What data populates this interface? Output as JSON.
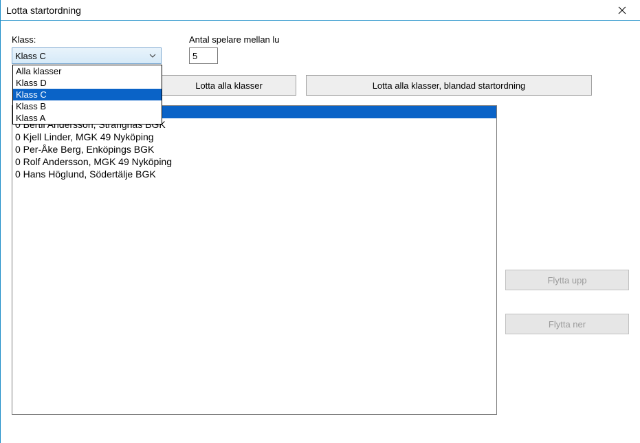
{
  "title": "Lotta startordning",
  "labels": {
    "klass": "Klass:",
    "antal": "Antal spelare mellan lu"
  },
  "combo": {
    "selected": "Klass C",
    "options": [
      "Alla klasser",
      "Klass D",
      "Klass C",
      "Klass B",
      "Klass A"
    ],
    "highlight": 2
  },
  "antal_value": "5",
  "buttons": {
    "lotta_alla": "Lotta alla klasser",
    "lotta_blandad": "Lotta alla klasser, blandad startordning",
    "flytta_upp": "Flytta upp",
    "flytta_ner": "Flytta ner"
  },
  "list": [
    "0 Bertil Andersson, Strängnäs BGK",
    "0 Kjell Linder, MGK 49 Nyköping",
    "0 Per-Åke Berg, Enköpings BGK",
    "0 Rolf Andersson, MGK 49 Nyköping",
    "0 Hans Höglund, Södertälje BGK"
  ]
}
